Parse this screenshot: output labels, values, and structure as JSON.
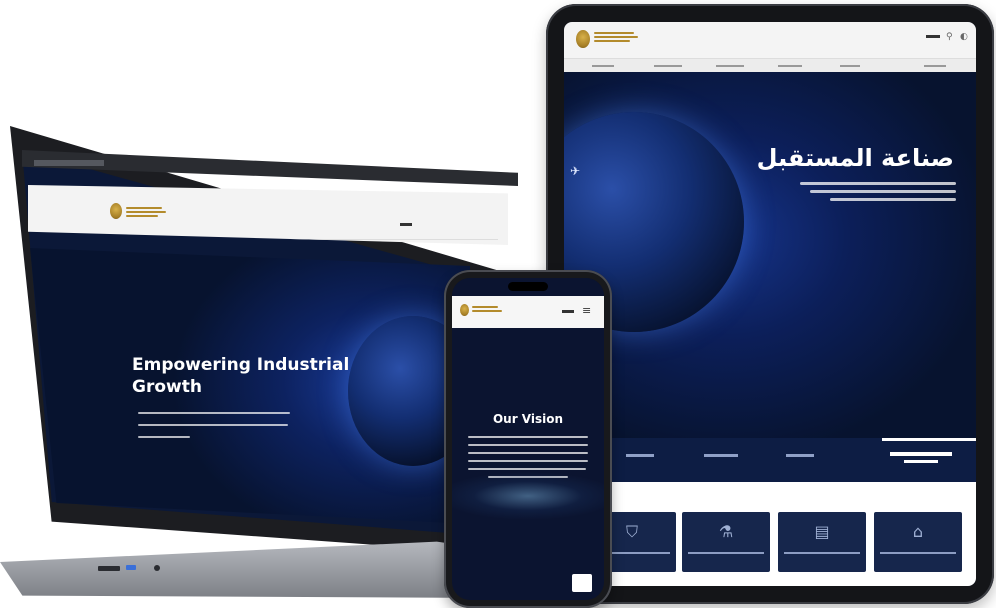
{
  "laptop": {
    "hero_title_line1": "Empowering Industrial",
    "hero_title_line2": "Growth"
  },
  "tablet": {
    "hero_title": "صناعة المستقبل"
  },
  "phone": {
    "section_title": "Our Vision"
  },
  "icons": {
    "shield": "shield-check-icon",
    "microscope": "microscope-icon",
    "document": "document-check-icon",
    "factory": "factory-icon",
    "menu": "hamburger-menu-icon",
    "search": "search-icon"
  },
  "colors": {
    "brand_navy": "#0b1a3e",
    "brand_gold": "#b38b2c",
    "card_navy": "#16264c"
  }
}
